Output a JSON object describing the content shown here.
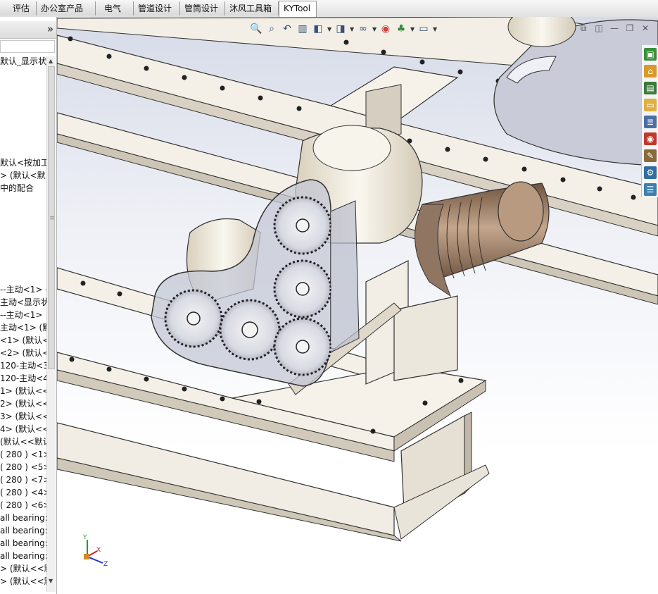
{
  "tabs": [
    {
      "label": "评估",
      "active": false
    },
    {
      "label": "办公室产品",
      "active": false
    },
    {
      "label": "电气",
      "active": false
    },
    {
      "label": "管道设计",
      "active": false
    },
    {
      "label": "管筒设计",
      "active": false
    },
    {
      "label": "沐风工具箱",
      "active": false
    },
    {
      "label": "KYTool",
      "active": true
    }
  ],
  "panel": {
    "collapse_glyph": "»"
  },
  "tree": [
    "默认_显示状",
    "默认<按加工",
    "> (默认<默",
    "中的配合",
    "--主动<1> -",
    "主动<显示状",
    "--主动<1>",
    "主动<1> (默",
    "<1> (默认<",
    "<2> (默认<",
    "120-主动<3",
    "120-主动<4",
    "1> (默认<<",
    "2> (默认<<",
    "3> (默认<<",
    "4> (默认<<",
    "(默认<<默认",
    "( 280 ) <1>",
    "( 280 ) <5>",
    "( 280 ) <7>",
    "( 280 ) <4>",
    "( 280 ) <6>",
    "all bearing:",
    "all bearing:",
    "all bearing:",
    "all bearing:",
    "> (默认<<默",
    "> (默认<<默"
  ],
  "triad": {
    "x": "X",
    "y": "Y",
    "z": "Z"
  },
  "colors": {
    "frame": "#f3efe6",
    "frame_shade": "#d9d2c4",
    "gear_glass": "#c6cad8",
    "motor": "#9b7d64",
    "background_top": "#d6dbe8"
  }
}
